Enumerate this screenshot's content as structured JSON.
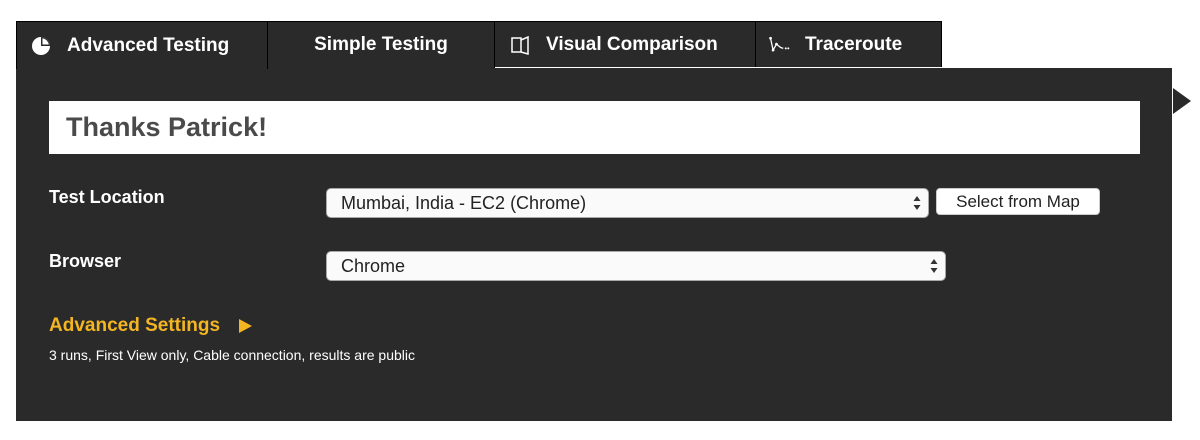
{
  "tabs": [
    {
      "label": "Advanced Testing",
      "icon": "pie-chart-icon",
      "active": true
    },
    {
      "label": "Simple Testing",
      "icon": "",
      "active": false
    },
    {
      "label": "Visual Comparison",
      "icon": "compare-pages-icon",
      "active": false
    },
    {
      "label": "Traceroute",
      "icon": "traceroute-icon",
      "active": false
    }
  ],
  "panel": {
    "greeting": "Thanks Patrick!",
    "test_location": {
      "label": "Test Location",
      "value": "Mumbai, India - EC2 (Chrome)",
      "map_button": "Select from Map"
    },
    "browser": {
      "label": "Browser",
      "value": "Chrome"
    },
    "advanced_settings": {
      "label": "Advanced Settings",
      "summary": "3 runs, First View only, Cable connection, results are public"
    }
  },
  "colors": {
    "panel_bg": "#2a2a2a",
    "accent": "#f3b521"
  }
}
